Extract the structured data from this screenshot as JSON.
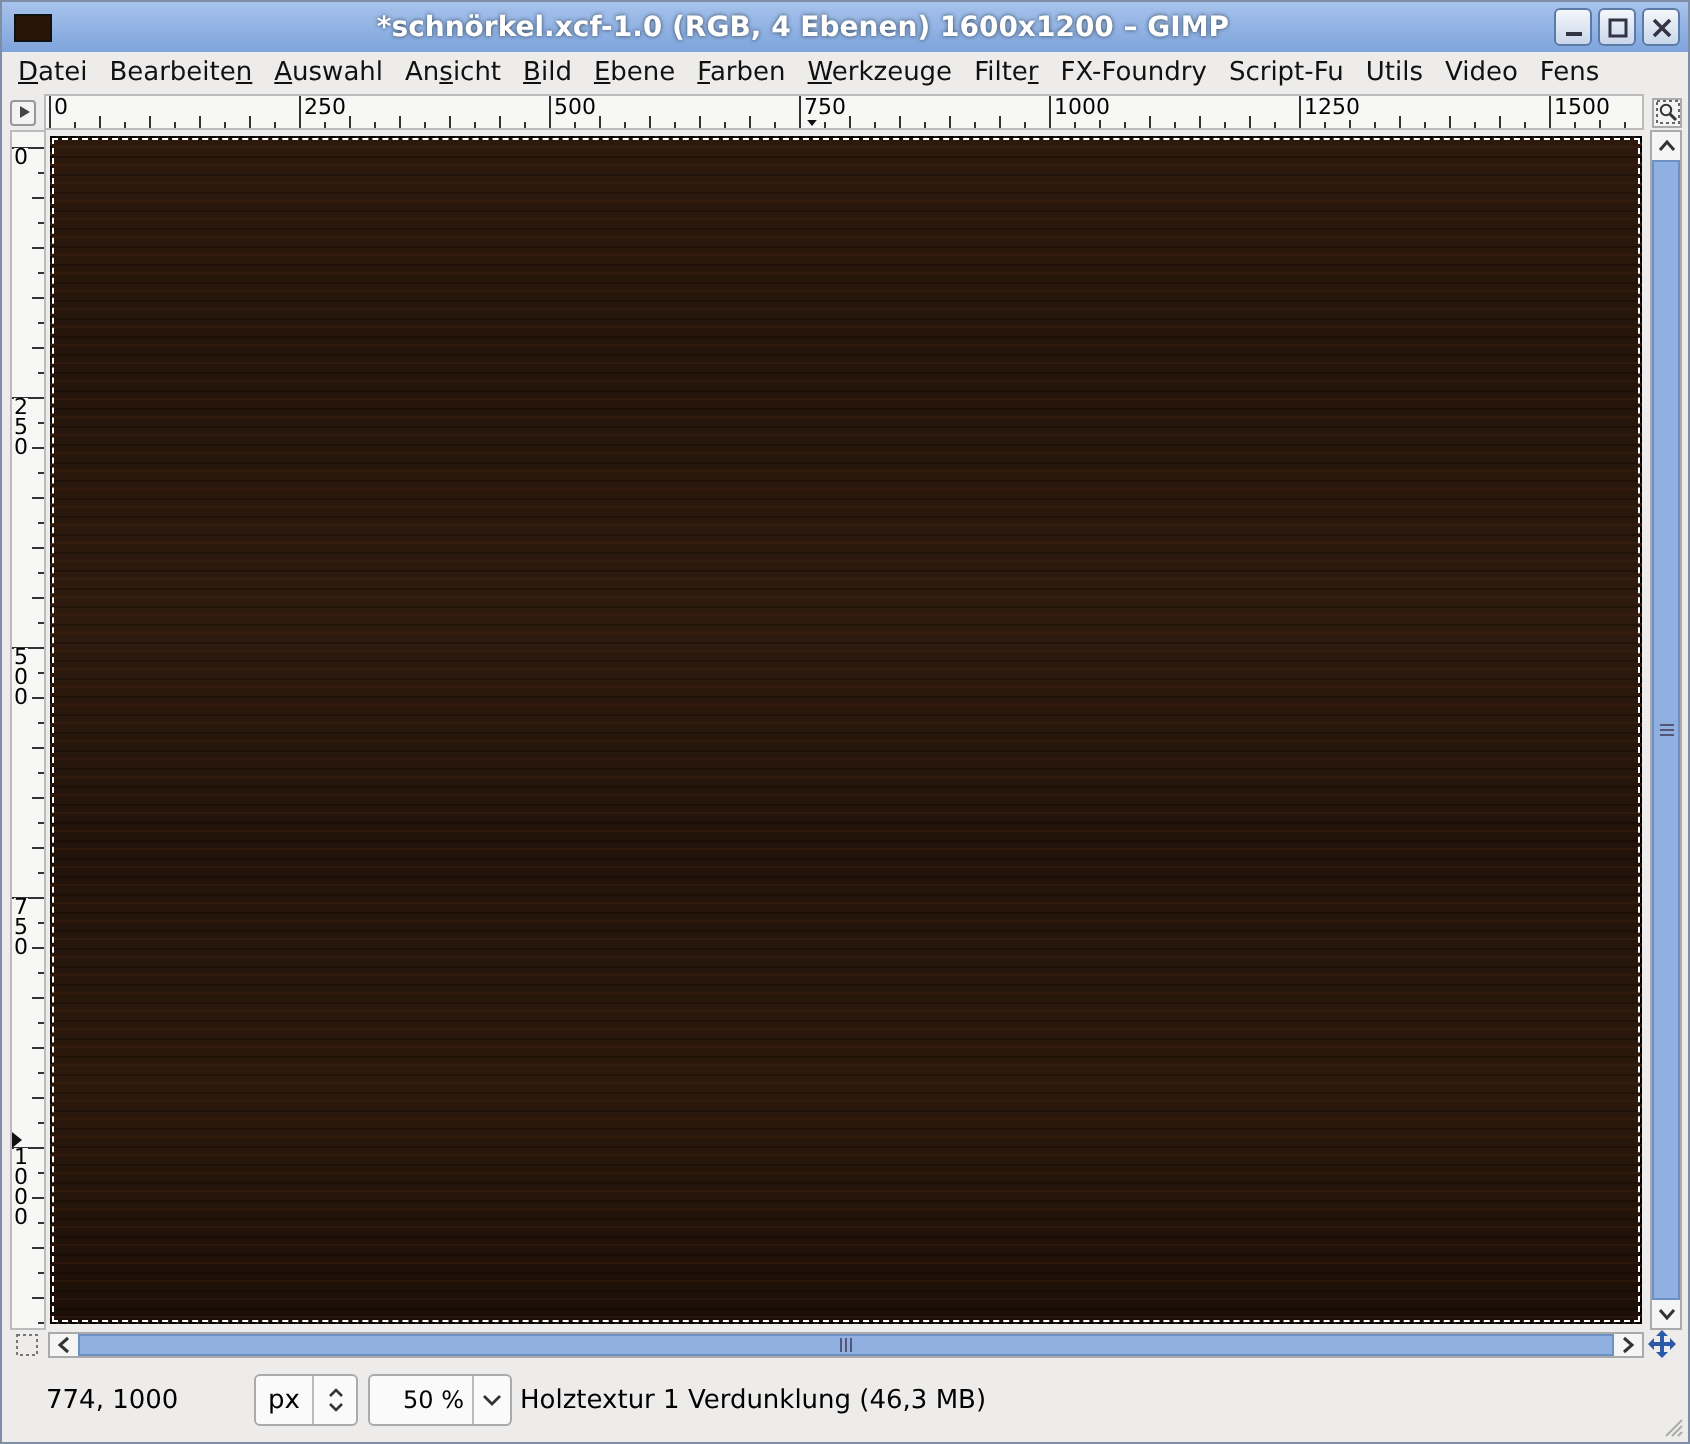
{
  "window": {
    "title": "*schnörkel.xcf-1.0 (RGB, 4 Ebenen) 1600x1200 – GIMP"
  },
  "menu": [
    {
      "key": "D",
      "after": "atei"
    },
    {
      "before": "Bearbeite",
      "key": "n"
    },
    {
      "key": "A",
      "after": "uswahl"
    },
    {
      "before": "An",
      "key": "s",
      "after": "icht"
    },
    {
      "key": "B",
      "after": "ild"
    },
    {
      "key": "E",
      "after": "bene"
    },
    {
      "key": "F",
      "after": "arben"
    },
    {
      "key": "W",
      "after": "erkzeuge"
    },
    {
      "before": "Filte",
      "key": "r"
    },
    {
      "before": "FX-Foundry"
    },
    {
      "before": "Script-Fu"
    },
    {
      "before": "Utils"
    },
    {
      "before": "Video"
    },
    {
      "before": "Fens"
    }
  ],
  "rulers": {
    "horizontal": [
      "0",
      "250",
      "500",
      "750",
      "1000",
      "1250",
      "1500"
    ],
    "vertical": [
      "0",
      "250",
      "500",
      "750",
      "1000"
    ]
  },
  "status_bar": {
    "coordinates": "774, 1000",
    "unit": "px",
    "zoom": "50 %",
    "message": "Holztextur 1 Verdunklung (46,3 MB)"
  }
}
